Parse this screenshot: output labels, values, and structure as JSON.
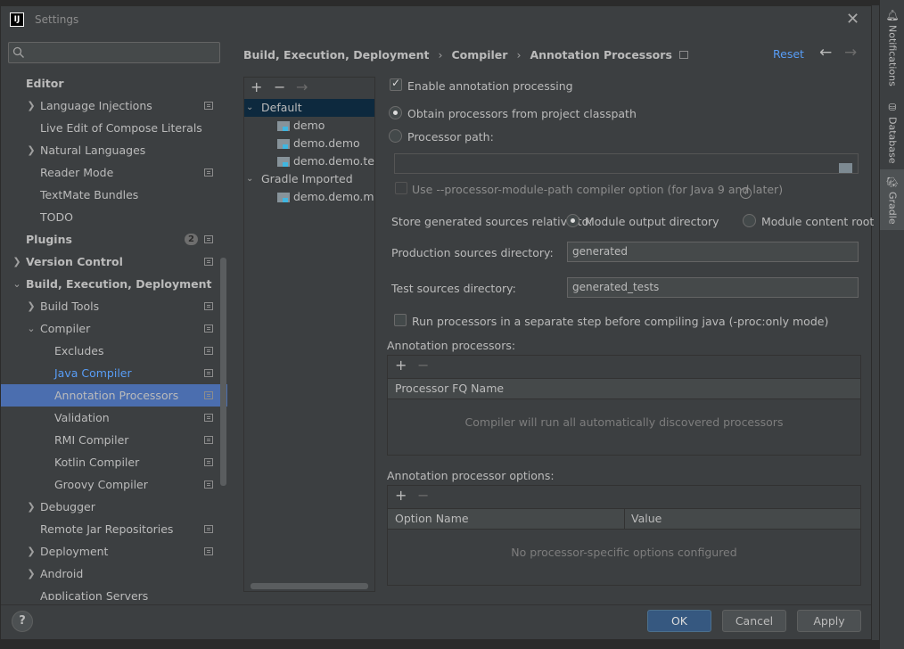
{
  "window": {
    "title": "Settings",
    "app_icon": "IJ"
  },
  "search": {
    "placeholder": ""
  },
  "tree": {
    "editor": "Editor",
    "language_injections": "Language Injections",
    "live_edit": "Live Edit of Compose Literals",
    "natural_languages": "Natural Languages",
    "reader_mode": "Reader Mode",
    "textmate": "TextMate Bundles",
    "todo": "TODO",
    "plugins": "Plugins",
    "plugins_badge": "2",
    "version_control": "Version Control",
    "build": "Build, Execution, Deployment",
    "build_tools": "Build Tools",
    "compiler": "Compiler",
    "excludes": "Excludes",
    "java_compiler": "Java Compiler",
    "annotation_processors": "Annotation Processors",
    "validation": "Validation",
    "rmi_compiler": "RMI Compiler",
    "kotlin_compiler": "Kotlin Compiler",
    "groovy_compiler": "Groovy Compiler",
    "debugger": "Debugger",
    "remote_jar": "Remote Jar Repositories",
    "deployment": "Deployment",
    "android": "Android",
    "app_servers": "Application Servers"
  },
  "breadcrumb": {
    "part1": "Build, Execution, Deployment",
    "part2": "Compiler",
    "part3": "Annotation Processors"
  },
  "reset_label": "Reset",
  "profiles": {
    "default": "Default",
    "demo": "demo",
    "demo_demo": "demo.demo",
    "demo_demo_test": "demo.demo.test",
    "gradle_imported": "Gradle Imported",
    "demo_demo_main": "demo.demo.main"
  },
  "options": {
    "enable_annotation": "Enable annotation processing",
    "obtain_from_classpath": "Obtain processors from project classpath",
    "processor_path": "Processor path:",
    "processor_path_value": "",
    "use_module_path": "Use --processor-module-path compiler option (for Java 9 and later)",
    "store_generated": "Store generated sources relative to:",
    "module_output_dir": "Module output directory",
    "module_content_root": "Module content root",
    "production_sources_label": "Production sources directory:",
    "production_sources_value": "generated",
    "test_sources_label": "Test sources directory:",
    "test_sources_value": "generated_tests",
    "run_separate_step": "Run processors in a separate step before compiling java (-proc:only mode)"
  },
  "annotation_processors_table": {
    "title": "Annotation processors:",
    "column": "Processor FQ Name",
    "empty": "Compiler will run all automatically discovered processors"
  },
  "processor_options_table": {
    "title": "Annotation processor options:",
    "col1": "Option Name",
    "col2": "Value",
    "empty": "No processor-specific options configured"
  },
  "buttons": {
    "help": "?",
    "ok": "OK",
    "cancel": "Cancel",
    "apply": "Apply"
  },
  "right_strip": {
    "notifications": "Notifications",
    "database": "Database",
    "gradle": "Gradle"
  },
  "colors": {
    "accent": "#4b6eaf",
    "link": "#589df6",
    "primary_button": "#365880",
    "background": "#3c3f41"
  }
}
